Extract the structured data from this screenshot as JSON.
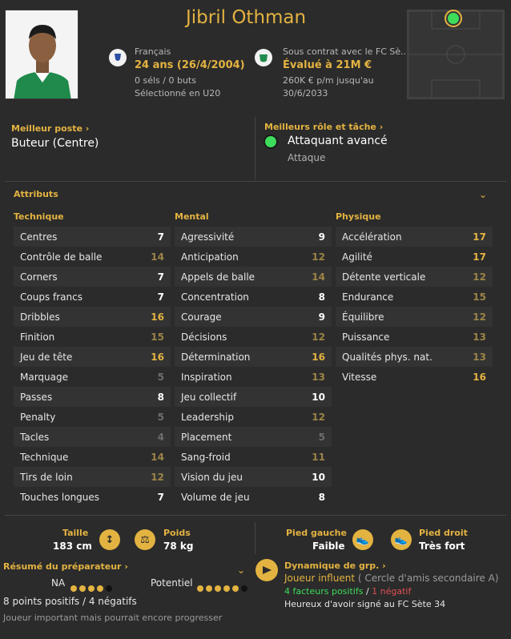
{
  "player": {
    "name": "Jibril Othman",
    "nationality": "Français",
    "age": "24 ans",
    "dob": "(26/4/2004)",
    "caps": "0 séls / 0 buts",
    "selection": "Sélectionné en U20",
    "contract": "Sous contrat avec le FC Sè...",
    "value": "Évalué à 21M €",
    "wage": "260K € p/m jusqu'au",
    "contract_end": "30/6/2033"
  },
  "best_position": {
    "label": "Meilleur poste",
    "value": "Buteur (Centre)"
  },
  "best_role": {
    "label": "Meilleurs rôle et tâche",
    "value": "Attaquant avancé",
    "duty": "Attaque"
  },
  "attributes": {
    "title": "Attributs",
    "technique": {
      "title": "Technique",
      "rows": [
        {
          "name": "Centres",
          "value": "7"
        },
        {
          "name": "Contrôle de balle",
          "value": "14"
        },
        {
          "name": "Corners",
          "value": "7"
        },
        {
          "name": "Coups francs",
          "value": "7"
        },
        {
          "name": "Dribbles",
          "value": "16"
        },
        {
          "name": "Finition",
          "value": "15"
        },
        {
          "name": "Jeu de tête",
          "value": "16"
        },
        {
          "name": "Marquage",
          "value": "5"
        },
        {
          "name": "Passes",
          "value": "8"
        },
        {
          "name": "Penalty",
          "value": "5"
        },
        {
          "name": "Tacles",
          "value": "4"
        },
        {
          "name": "Technique",
          "value": "14"
        },
        {
          "name": "Tirs de loin",
          "value": "12"
        },
        {
          "name": "Touches longues",
          "value": "7"
        }
      ]
    },
    "mental": {
      "title": "Mental",
      "rows": [
        {
          "name": "Agressivité",
          "value": "9"
        },
        {
          "name": "Anticipation",
          "value": "12"
        },
        {
          "name": "Appels de balle",
          "value": "14"
        },
        {
          "name": "Concentration",
          "value": "8"
        },
        {
          "name": "Courage",
          "value": "9"
        },
        {
          "name": "Décisions",
          "value": "12"
        },
        {
          "name": "Détermination",
          "value": "16"
        },
        {
          "name": "Inspiration",
          "value": "13"
        },
        {
          "name": "Jeu collectif",
          "value": "10"
        },
        {
          "name": "Leadership",
          "value": "12"
        },
        {
          "name": "Placement",
          "value": "5"
        },
        {
          "name": "Sang-froid",
          "value": "11"
        },
        {
          "name": "Vision du jeu",
          "value": "10"
        },
        {
          "name": "Volume de jeu",
          "value": "8"
        }
      ]
    },
    "physique": {
      "title": "Physique",
      "rows": [
        {
          "name": "Accélération",
          "value": "17"
        },
        {
          "name": "Agilité",
          "value": "17"
        },
        {
          "name": "Détente verticale",
          "value": "12"
        },
        {
          "name": "Endurance",
          "value": "15"
        },
        {
          "name": "Équilibre",
          "value": "12"
        },
        {
          "name": "Puissance",
          "value": "13"
        },
        {
          "name": "Qualités phys. nat.",
          "value": "13"
        },
        {
          "name": "Vitesse",
          "value": "16"
        }
      ]
    }
  },
  "physical": {
    "height_label": "Taille",
    "height": "183 cm",
    "weight_label": "Poids",
    "weight": "78 kg",
    "left_foot_label": "Pied gauche",
    "left_foot": "Faible",
    "right_foot_label": "Pied droit",
    "right_foot": "Très fort"
  },
  "coach_report": {
    "title": "Résumé du préparateur",
    "na_label": "NA",
    "na_stars": 4,
    "potential_label": "Potentiel",
    "potential_stars": 5,
    "points": "8 points positifs / 4 négatifs",
    "summary": "Joueur important mais pourrait encore progresser"
  },
  "group_dynamics": {
    "title": "Dynamique de grp.",
    "status": "Joueur influent",
    "circle": "( Cercle d'amis secondaire A)",
    "positive": "4 facteurs positifs",
    "slash": "/",
    "negative": "1 négatif",
    "note": "Heureux d'avoir signé au FC Sète 34"
  },
  "colors": {
    "accent": "#e3b341",
    "background": "#2b2b2b",
    "positive": "#3ddc5b",
    "negative": "#e05050"
  }
}
